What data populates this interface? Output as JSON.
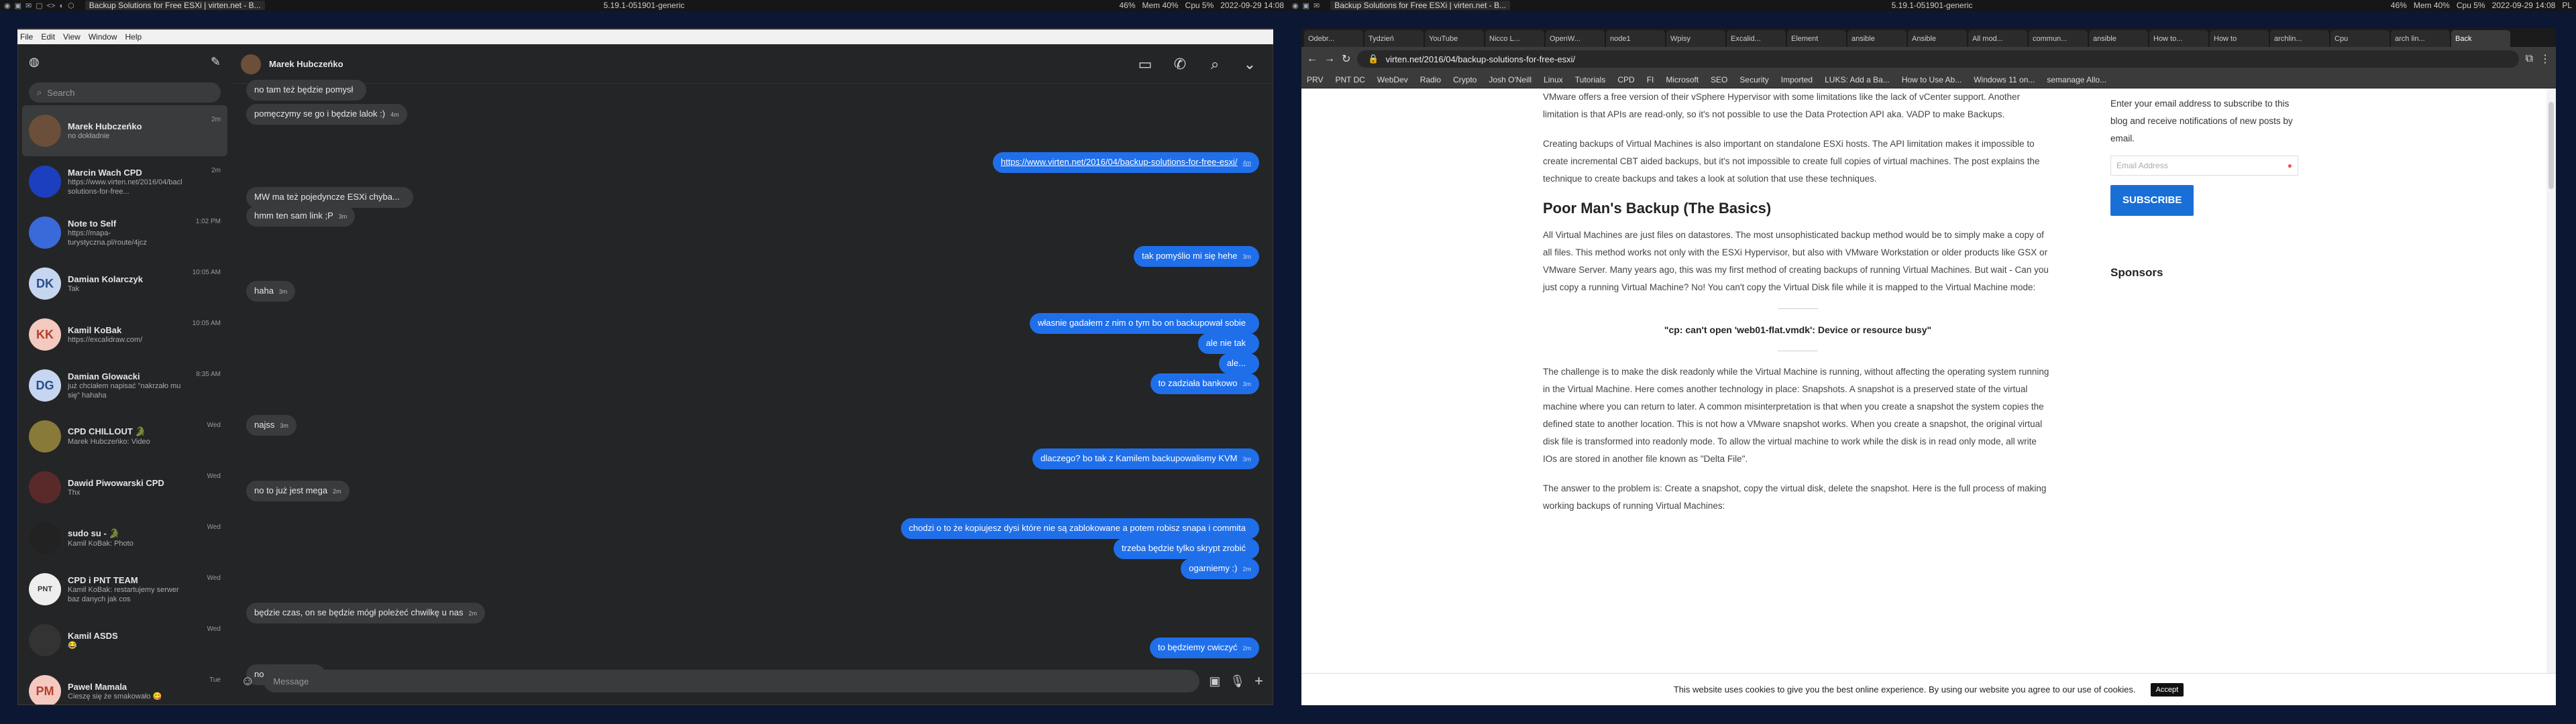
{
  "panel_left": {
    "apps": [
      "◉",
      "▣",
      "✉",
      "▢",
      "<>",
      "◐",
      "⬡"
    ],
    "task": "Backup Solutions for Free ESXi | virten.net - B...",
    "kernel": "5.19.1-051901-generic",
    "vol": "46%",
    "mem": "Mem 40%",
    "cpu": "Cpu   5%",
    "clock": "2022-09-29 14:08"
  },
  "panel_right": {
    "apps": [
      "◉",
      "▣",
      "✉"
    ],
    "task": "Backup Solutions for Free ESXi | virten.net - B...",
    "kernel": "5.19.1-051901-generic",
    "vol": "46%",
    "mem": "Mem 40%",
    "cpu": "Cpu   5%",
    "clock": "2022-09-29 14:08",
    "lang": "PL"
  },
  "menubar": {
    "items": [
      "File",
      "Edit",
      "View",
      "Window",
      "Help"
    ]
  },
  "messenger": {
    "search_placeholder": "Search",
    "chat_title": "Marek Hubczeńko",
    "message_placeholder": "Message",
    "conversations": [
      {
        "name": "Marek Hubczeńko",
        "preview": "no dokładnie",
        "time": "2m",
        "color": "#6b4f3a",
        "initials": ""
      },
      {
        "name": "Marcin Wach CPD",
        "preview": "https://www.virten.net/2016/04/backup-solutions-for-free...",
        "time": "2m",
        "color": "#1b3fbf",
        "initials": ""
      },
      {
        "name": "Note to Self",
        "preview": "https://mapa-turystyczna.pl/route/4jcz",
        "time": "1:02 PM",
        "color": "#3a6ad9",
        "initials": ""
      },
      {
        "name": "Damian Kolarczyk",
        "preview": "Tak",
        "time": "10:05 AM",
        "color": "#c6d6f0",
        "initials": "DK"
      },
      {
        "name": "Kamil KoBak",
        "preview": "https://excalidraw.com/",
        "time": "10:05 AM",
        "color": "#f3c9c0",
        "initials": "KK"
      },
      {
        "name": "Damian Glowacki",
        "preview": "już chciałem napisać \"nakrzało mu się\" hahaha",
        "time": "8:35 AM",
        "color": "#c6d6f0",
        "initials": "DG"
      },
      {
        "name": "CPD CHILLOUT  🐊",
        "preview": "Marek Hubczeńko: Video",
        "time": "Wed",
        "color": "#8a7a3a",
        "initials": ""
      },
      {
        "name": "Dawid Piwowarski CPD",
        "preview": "Thx",
        "time": "Wed",
        "color": "#5a2a2a",
        "initials": ""
      },
      {
        "name": "sudo su -  🐊",
        "preview": "Kamil KoBak: Photo",
        "time": "Wed",
        "color": "#222222",
        "initials": ""
      },
      {
        "name": "CPD i PNT TEAM",
        "preview": "Kamil KoBak: restartujemy serwer baz danych jak cos",
        "time": "Wed",
        "color": "#eeeeee",
        "initials": "PNT"
      },
      {
        "name": "Kamil ASDS",
        "preview": "😂",
        "time": "Wed",
        "color": "#333333",
        "initials": ""
      },
      {
        "name": "Pawel Mamala",
        "preview": "Cieszę się że smakowało 😋",
        "time": "Tue",
        "color": "#f3c9c0",
        "initials": "PM"
      }
    ],
    "messages": [
      {
        "dir": "in",
        "text": "no tam też będzie pomysł",
        "time": ""
      },
      {
        "dir": "in",
        "text": "pomęczymy se go i będzie lalok :)",
        "time": "4m"
      },
      {
        "dir": "out",
        "text": "https://www.virten.net/2016/04/backup-solutions-for-free-esxi/",
        "time": "4m"
      },
      {
        "dir": "in",
        "text": "MW ma też pojedyncze ESXi chyba...",
        "time": ""
      },
      {
        "dir": "in",
        "text": "hmm ten sam link ;P",
        "time": "3m"
      },
      {
        "dir": "out",
        "text": "tak pomyślio mi się hehe",
        "time": "3m"
      },
      {
        "dir": "in",
        "text": "haha",
        "time": "3m"
      },
      {
        "dir": "out",
        "text": "własnie gadałem z nim o tym bo on backupował sobie",
        "time": ""
      },
      {
        "dir": "out",
        "text": "ale nie tak",
        "time": ""
      },
      {
        "dir": "out",
        "text": "ale...",
        "time": ""
      },
      {
        "dir": "out",
        "text": "to zadziała bankowo",
        "time": "3m"
      },
      {
        "dir": "in",
        "text": "najss",
        "time": "3m"
      },
      {
        "dir": "out",
        "text": "dlaczego? bo tak z Kamilem backupowalismy KVM",
        "time": "3m"
      },
      {
        "dir": "in",
        "text": "no to już jest mega",
        "time": "2m"
      },
      {
        "dir": "out",
        "text": "chodzi o to że kopiujesz dysi które nie są zablokowane a potem robisz snapa i commita",
        "time": ""
      },
      {
        "dir": "out",
        "text": "trzeba będzie tylko skrypt zrobić",
        "time": ""
      },
      {
        "dir": "out",
        "text": "ogarniemy :)",
        "time": "2m"
      },
      {
        "dir": "in",
        "text": "będzie czas, on se będzie mógł poleżeć chwilkę u nas",
        "time": "2m"
      },
      {
        "dir": "out",
        "text": "to będziemy cwiczyć",
        "time": "2m"
      },
      {
        "dir": "in",
        "text": "no dokładnie",
        "time": "1m"
      }
    ]
  },
  "browser": {
    "tabs": [
      "Odebr...",
      "Tydzień",
      "YouTube",
      "Nicco L...",
      "OpenW...",
      "node1",
      "Wpisy",
      "Excalid...",
      "Element",
      "ansible",
      "Ansible",
      "All mod...",
      "commun...",
      "ansible",
      "How to...",
      "How to",
      "archlin...",
      "Cpu",
      "arch lin...",
      "Back"
    ],
    "url": "virten.net/2016/04/backup-solutions-for-free-esxi/",
    "bookmarks": [
      "PRV",
      "PNT DC",
      "WebDev",
      "Radio",
      "Crypto",
      "Josh O'Neill",
      "Linux",
      "Tutorials",
      "CPD",
      "FI",
      "Microsoft",
      "SEO",
      "Security",
      "Imported",
      "LUKS: Add a Ba...",
      "How to Use Ab...",
      "Windows 11 on...",
      "semanage Allo..."
    ],
    "article": {
      "p0": "VMware offers a free version of their vSphere Hypervisor with some limitations like the lack of vCenter support. Another limitation is that APIs are read-only, so it's not possible to use the Data Protection API aka. VADP to make Backups.",
      "p1": "Creating backups of Virtual Machines is also important on standalone ESXi hosts. The API limitation makes it impossible to create incremental CBT aided backups, but it's not impossible to create full copies of virtual machines. The post explains the technique to create backups and takes a look at solution that use these techniques.",
      "h2": "Poor Man's Backup (The Basics)",
      "p2": "All Virtual Machines are just files on datastores. The most unsophisticated backup method would be to simply make a copy of all files. This method works not only with the ESXi Hypervisor, but also with VMware Workstation or older products like GSX or VMware Server. Many years ago, this was my first method of creating backups of running Virtual Machines. But wait - Can you just copy a running Virtual Machine? No! You can't copy the Virtual Disk file while it is mapped to the Virtual Machine mode:",
      "h3": "\"cp: can't open 'web01-flat.vmdk': Device or resource busy\"",
      "p3": "The challenge is to make the disk readonly while the Virtual Machine is running, without affecting the operating system running in the Virtual Machine. Here comes another technology in place: Snapshots. A snapshot is a preserved state of the virtual machine where you can return to later. A common misinterpretation is that when you create a snapshot the system copies the defined state to another location. This is not how a VMware snapshot works. When you create a snapshot, the original virtual disk file is transformed into readonly mode. To allow the virtual machine to work while the disk is in read only mode, all write IOs are stored in another file known as \"Delta File\".",
      "p4": "The answer to the problem is: Create a snapshot, copy the virtual disk, delete the snapshot. Here is the full process of making working backups of running Virtual Machines:"
    },
    "sidebar": {
      "subscribe_text": "Enter your email address to subscribe to this blog and receive notifications of new posts by email.",
      "email_placeholder": "Email Address",
      "subscribe_btn": "SUBSCRIBE",
      "sponsors": "Sponsors"
    },
    "cookie": {
      "text": "This website uses cookies to give you the best online experience. By using our website you agree to our use of cookies.",
      "accept": "Accept"
    }
  }
}
